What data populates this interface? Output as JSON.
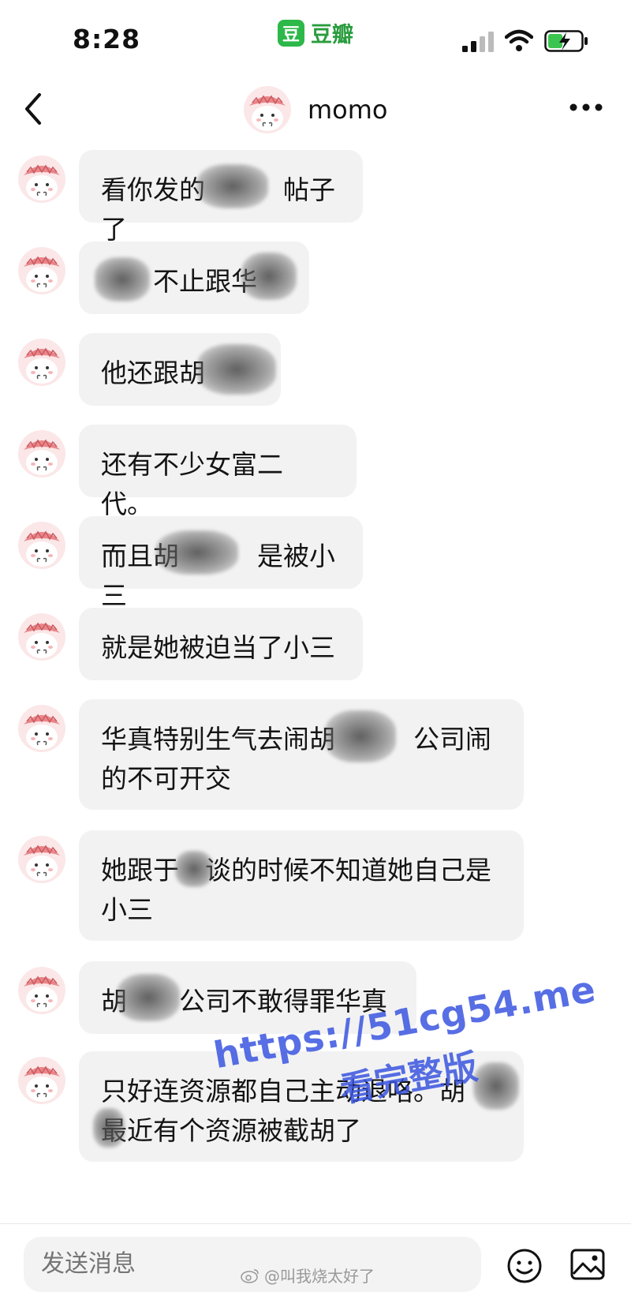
{
  "status_bar": {
    "time": "8:28",
    "app_logo_char": "豆",
    "app_name": "豆瓣",
    "accent_green": "#2db84a"
  },
  "header": {
    "name": "momo"
  },
  "messages": [
    {
      "text": "看你发的　　　帖子了"
    },
    {
      "text": "　　不止跟华　　"
    },
    {
      "text": "他还跟胡　　　"
    },
    {
      "text": "还有不少女富二代。"
    },
    {
      "text": "而且胡　　　是被小三"
    },
    {
      "text": "就是她被迫当了小三"
    },
    {
      "text": "华真特别生气去闹胡　　　公司闹的不可开交"
    },
    {
      "text": "她跟于　谈的时候不知道她自己是小三"
    },
    {
      "text": "胡　　公司不敢得罪华真"
    },
    {
      "text": "只好连资源都自己主动退咯。胡　　最近有个资源被截胡了"
    }
  ],
  "watermark": {
    "url": "https://51cg54.me",
    "subtitle": "看完整版",
    "color": "#3a55e0"
  },
  "input_bar": {
    "placeholder": "发送消息",
    "credit": "@叫我烧太好了"
  }
}
